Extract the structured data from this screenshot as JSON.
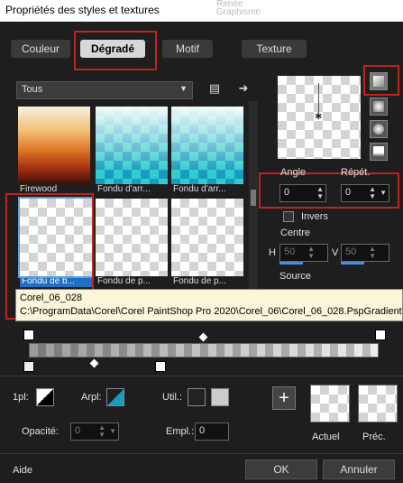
{
  "window": {
    "title": "Propriétés des styles et textures",
    "watermark": "Renée Graphisme"
  },
  "tabs": [
    {
      "label": "Couleur",
      "active": false
    },
    {
      "label": "Dégradé",
      "active": true
    },
    {
      "label": "Motif",
      "active": false
    },
    {
      "label": "Texture",
      "active": false
    }
  ],
  "filter": {
    "selected": "Tous"
  },
  "gradients": [
    {
      "label": "Firewood"
    },
    {
      "label": "Fondu d'arr..."
    },
    {
      "label": "Fondu d'arr..."
    },
    {
      "label": "Fondu de b..."
    },
    {
      "label": "Fondu de p..."
    },
    {
      "label": "Fondu de p..."
    }
  ],
  "tooltip": {
    "name": "Corel_06_028",
    "path": "C:\\ProgramData\\Corel\\Corel PaintShop Pro 2020\\Corel_06\\Corel_06_028.PspGradient"
  },
  "properties": {
    "angle_label": "Angle",
    "angle_value": "0",
    "repeat_label": "Répét.",
    "repeat_value": "0",
    "invert_label": "Invers",
    "center_label": "Centre",
    "h_label": "H",
    "h_value": "50",
    "v_label": "V",
    "v_value": "50",
    "source_label": "Source"
  },
  "bottom": {
    "pl_label": "1pl:",
    "arpl_label": "Arpl:",
    "util_label": "Util.:",
    "opacity_label": "Opacité:",
    "opacity_value": "0",
    "empl_label": "Empl.:",
    "empl_value": "0",
    "current_label": "Actuel",
    "previous_label": "Préc."
  },
  "footer": {
    "help": "Aide",
    "ok": "OK",
    "cancel": "Annuler"
  },
  "colors": {
    "accent": "#c0231e",
    "selection": "#1f6fc4",
    "slider": "#4a8fd8"
  },
  "icons": [
    "palette-icon",
    "arrow-right-icon",
    "star-icon",
    "plus-icon"
  ]
}
